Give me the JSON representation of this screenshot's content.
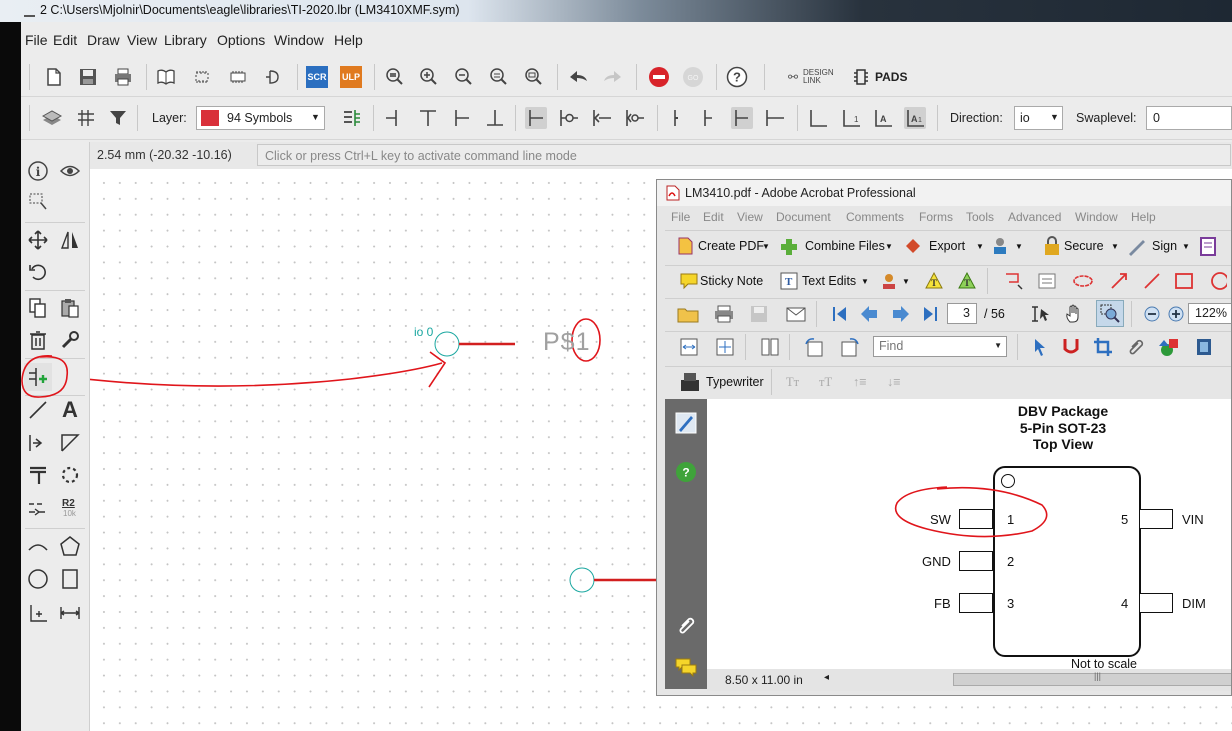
{
  "window": {
    "title": "2 C:\\Users\\Mjolnir\\Documents\\eagle\\libraries\\TI-2020.lbr (LM3410XMF.sym)"
  },
  "menu": [
    "File",
    "Edit",
    "Draw",
    "View",
    "Library",
    "Options",
    "Window",
    "Help"
  ],
  "toolbar": {
    "scr_label": "SCR",
    "ulp_label": "ULP",
    "design_link_line1": "DESIGN",
    "design_link_line2": "LINK",
    "pads_label": "PADS"
  },
  "params": {
    "layer_label": "Layer:",
    "layer_value": "94 Symbols",
    "layer_color": "#d9303a",
    "direction_label": "Direction:",
    "direction_value": "io",
    "swaplevel_label": "Swaplevel:",
    "swaplevel_value": "0"
  },
  "palette": {
    "text_tool": "A",
    "r2_top": "R2",
    "r2_bottom": "10k"
  },
  "cmdline": {
    "coordinates": "2.54 mm (-20.32 -10.16)",
    "placeholder": "Click or press Ctrl+L key to activate command line mode"
  },
  "canvas": {
    "pin_label": "io 0",
    "pin_name": "P$1",
    "annotation_color": "#e0151b",
    "pin_color": "#1aa7a0",
    "line_color": "#d21f1f"
  },
  "acrobat": {
    "title": "LM3410.pdf - Adobe Acrobat Professional",
    "menu": [
      "File",
      "Edit",
      "View",
      "Document",
      "Comments",
      "Forms",
      "Tools",
      "Advanced",
      "Window",
      "Help"
    ],
    "toolbar1": [
      "Create PDF",
      "Combine Files",
      "Export",
      "Secure",
      "Sign"
    ],
    "toolbar2": {
      "sticky_note": "Sticky Note",
      "text_edits": "Text Edits"
    },
    "nav": {
      "page": "3",
      "total": "/ 56",
      "zoom": "122%"
    },
    "find_placeholder": "Find",
    "typewriter": "Typewriter",
    "tt_big": "Tт",
    "tt_small": "тT",
    "status_size": "8.50 x 11.00 in",
    "document": {
      "heading": [
        "DBV Package",
        "5-Pin SOT-23",
        "Top View"
      ],
      "pins_left": [
        {
          "name": "SW",
          "num": "1"
        },
        {
          "name": "GND",
          "num": "2"
        },
        {
          "name": "FB",
          "num": "3"
        }
      ],
      "pins_right": [
        {
          "name": "VIN",
          "num": "5"
        },
        {
          "name": "DIM",
          "num": "4"
        }
      ],
      "footnote": "Not to scale"
    }
  }
}
